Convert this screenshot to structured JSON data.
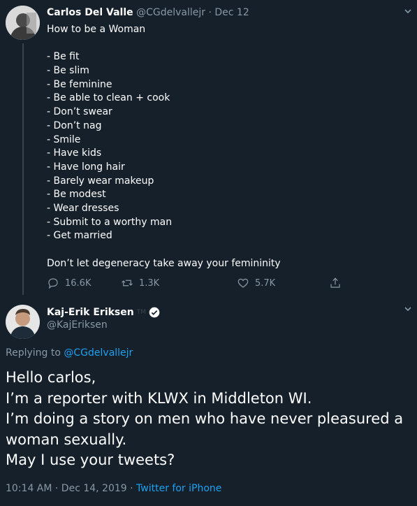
{
  "tweet1": {
    "author_name": "Carlos Del Valle",
    "author_handle": "@CGdelvallejr",
    "separator": "·",
    "date": "Dec 12",
    "lines": [
      "How to be a Woman",
      "",
      "- Be fit",
      "- Be slim",
      "- Be feminine",
      "- Be able to clean + cook",
      "- Don’t swear",
      "- Don’t nag",
      "- Smile",
      "- Have kids",
      "- Have long hair",
      "- Barely wear makeup",
      "- Be modest",
      "- Wear dresses",
      "- Submit to a worthy man",
      "- Get married",
      "",
      "Don’t let degeneracy take away your femininity"
    ],
    "replies": "16.6K",
    "retweets": "1.3K",
    "likes": "5.7K"
  },
  "tweet2": {
    "author_name": "Kaj-Erik Eriksen",
    "tm": "TM",
    "author_handle": "@KajEriksen",
    "replying_prefix": "Replying to",
    "replying_mention": "@CGdelvallejr",
    "lines": [
      "Hello carlos,",
      "I’m a reporter with KLWX in Middleton WI.",
      "I’m doing a story on men who have never pleasured a",
      "woman sexually.",
      "May I use your tweets?"
    ],
    "timestamp": "10:14 AM · Dec 14, 2019 ·",
    "source": "Twitter for iPhone"
  },
  "icons": {
    "reply": "speech-bubble-icon",
    "retweet": "retweet-icon",
    "like": "heart-icon",
    "share": "share-icon",
    "verified": "verified-badge-icon",
    "more": "chevron-down-icon"
  },
  "colors": {
    "background": "#15202b",
    "text": "#ffffff",
    "secondary": "#8899a6",
    "accent": "#1da1f2",
    "divider": "#38444d"
  }
}
